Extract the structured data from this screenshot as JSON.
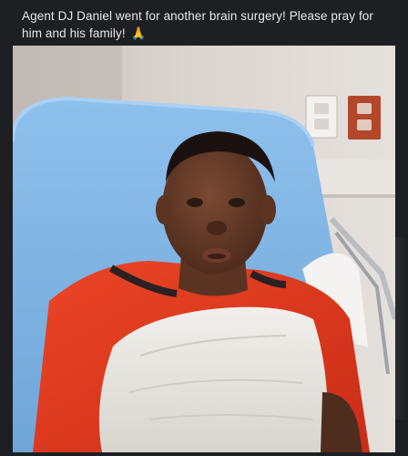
{
  "post": {
    "caption": "Agent DJ Daniel went for another brain surgery! Please pray for him and his family!",
    "caption_emoji": "🙏"
  },
  "colors": {
    "background": "#1e1f22",
    "text": "#e8e8ea",
    "bed": "#7fb6e6",
    "shirt": "#e0361f",
    "blanket": "#e8e6e2"
  },
  "media": {
    "icon": "video-frame"
  }
}
